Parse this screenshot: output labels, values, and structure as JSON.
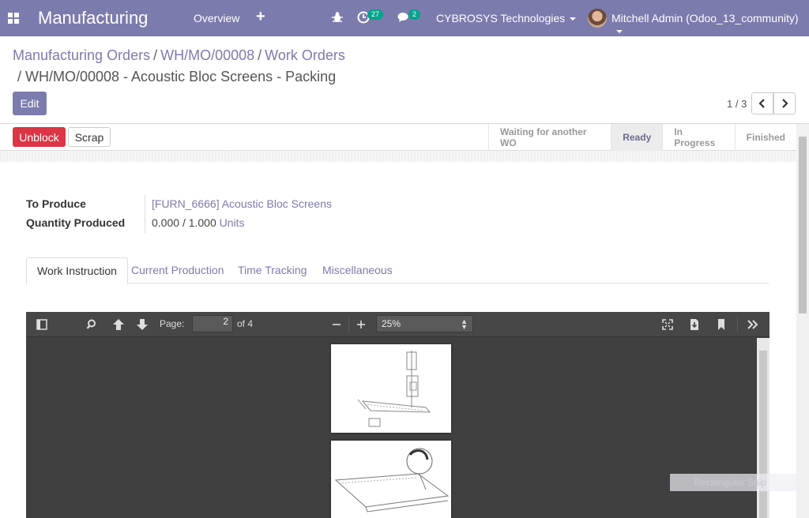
{
  "navbar": {
    "app_name": "Manufacturing",
    "overview": "Overview",
    "plus": "+",
    "activity_count": "27",
    "message_count": "2",
    "company": "CYBROSYS Technologies",
    "user": "Mitchell Admin (Odoo_13_community)"
  },
  "breadcrumb": {
    "items": [
      "Manufacturing Orders",
      "WH/MO/00008",
      "Work Orders"
    ],
    "separator": "/",
    "current": "/ WH/MO/00008 - Acoustic Bloc Screens - Packing"
  },
  "controls": {
    "edit_label": "Edit",
    "pager": "1 / 3"
  },
  "statusbar": {
    "unblock_label": "Unblock",
    "scrap_label": "Scrap",
    "stages": [
      "Waiting for another WO",
      "Ready",
      "In Progress",
      "Finished"
    ],
    "active_stage": "Ready"
  },
  "form": {
    "to_produce_label": "To Produce",
    "to_produce_value": "[FURN_6666] Acoustic Bloc Screens",
    "qty_label": "Quantity Produced",
    "qty_produced": "0.000",
    "qty_sep": "/",
    "qty_total": "1.000",
    "qty_unit": "Units"
  },
  "tabs": [
    "Work Instruction",
    "Current Production",
    "Time Tracking",
    "Miscellaneous"
  ],
  "active_tab": "Work Instruction",
  "pdf_viewer": {
    "page_label": "Page:",
    "page_value": "2",
    "page_of": "of 4",
    "zoom": "25%"
  },
  "tooltip_text": "Rectangular Snip"
}
